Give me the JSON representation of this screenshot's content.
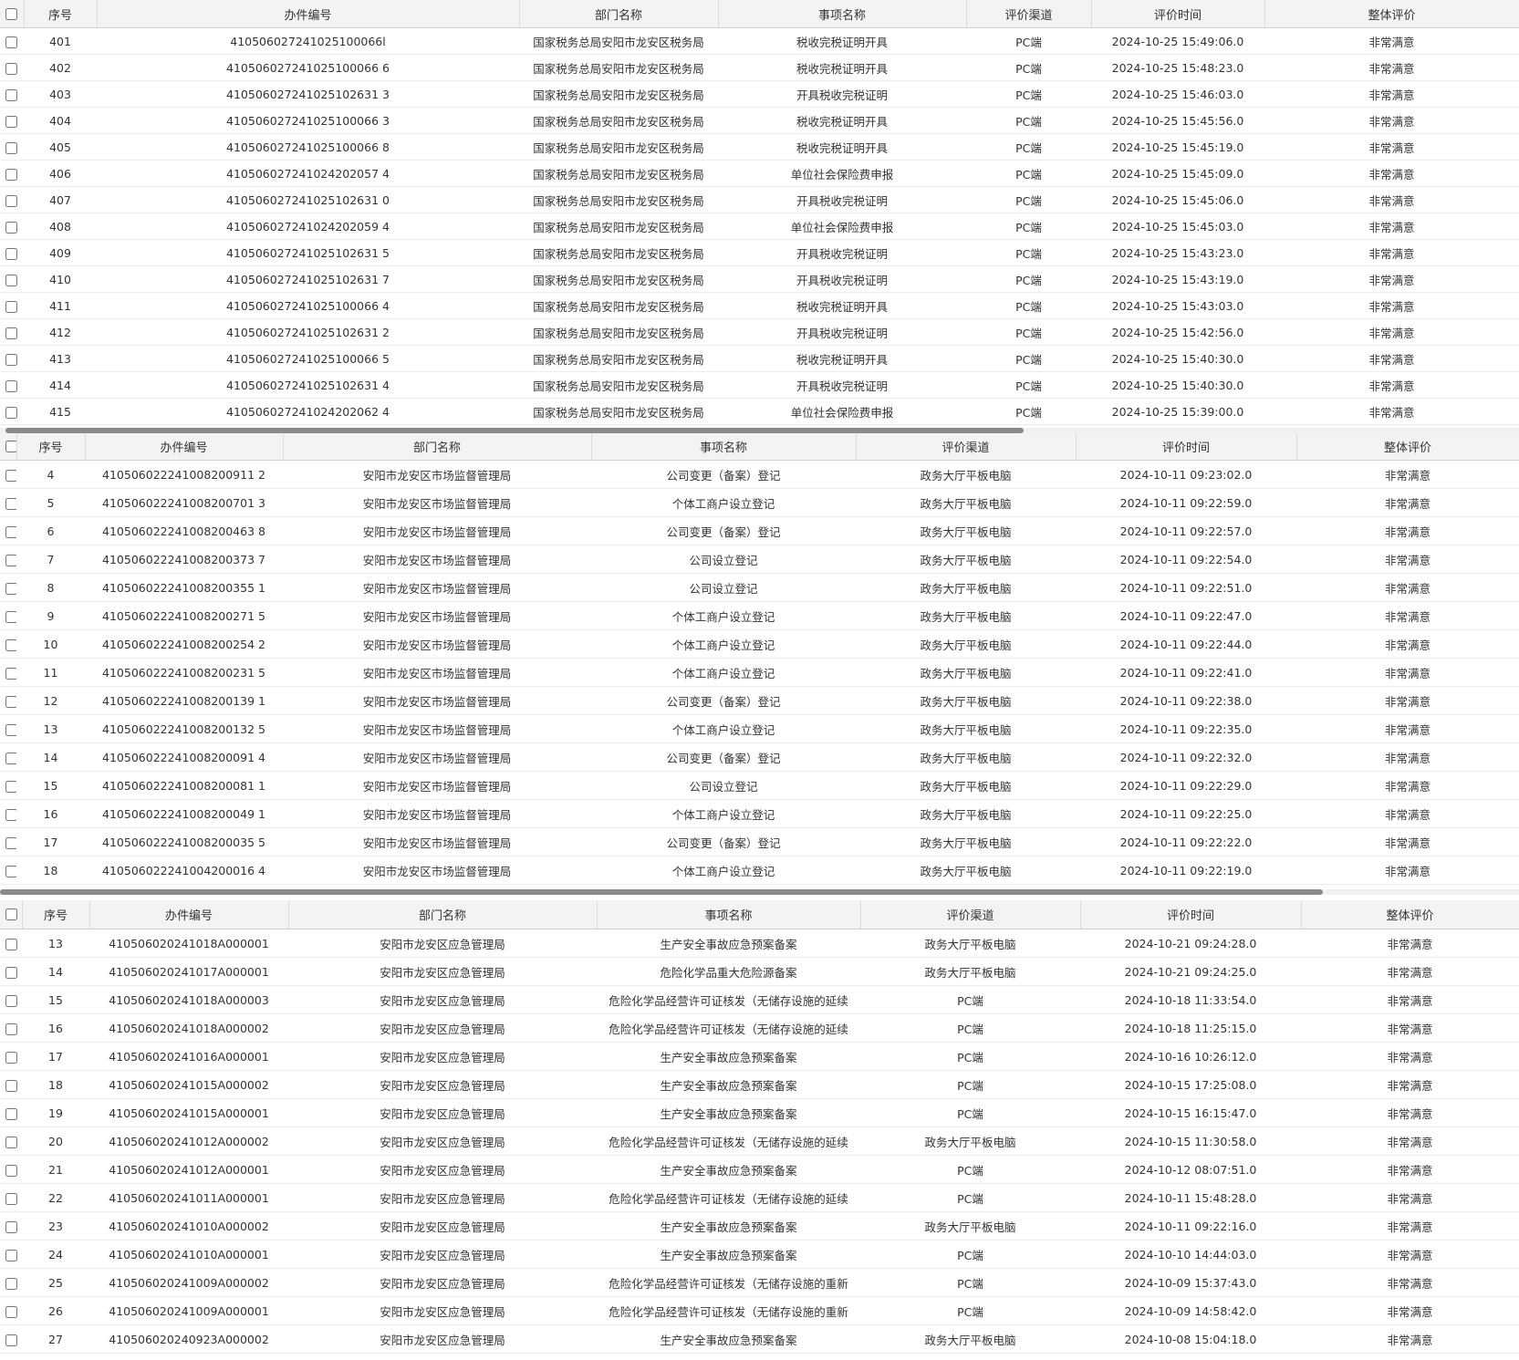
{
  "tables": [
    {
      "headers": [
        "序号",
        "办件编号",
        "部门名称",
        "事项名称",
        "评价渠道",
        "评价时间",
        "整体评价"
      ],
      "rows": [
        [
          "401",
          "410506027241025100066l",
          "国家税务总局安阳市龙安区税务局",
          "税收完税证明开具",
          "PC端",
          "2024-10-25 15:49:06.0",
          "非常满意"
        ],
        [
          "402",
          "410506027241025100066 6",
          "国家税务总局安阳市龙安区税务局",
          "税收完税证明开具",
          "PC端",
          "2024-10-25 15:48:23.0",
          "非常满意"
        ],
        [
          "403",
          "410506027241025102631 3",
          "国家税务总局安阳市龙安区税务局",
          "开具税收完税证明",
          "PC端",
          "2024-10-25 15:46:03.0",
          "非常满意"
        ],
        [
          "404",
          "410506027241025100066 3",
          "国家税务总局安阳市龙安区税务局",
          "税收完税证明开具",
          "PC端",
          "2024-10-25 15:45:56.0",
          "非常满意"
        ],
        [
          "405",
          "410506027241025100066 8",
          "国家税务总局安阳市龙安区税务局",
          "税收完税证明开具",
          "PC端",
          "2024-10-25 15:45:19.0",
          "非常满意"
        ],
        [
          "406",
          "410506027241024202057 4",
          "国家税务总局安阳市龙安区税务局",
          "单位社会保险费申报",
          "PC端",
          "2024-10-25 15:45:09.0",
          "非常满意"
        ],
        [
          "407",
          "410506027241025102631 0",
          "国家税务总局安阳市龙安区税务局",
          "开具税收完税证明",
          "PC端",
          "2024-10-25 15:45:06.0",
          "非常满意"
        ],
        [
          "408",
          "410506027241024202059 4",
          "国家税务总局安阳市龙安区税务局",
          "单位社会保险费申报",
          "PC端",
          "2024-10-25 15:45:03.0",
          "非常满意"
        ],
        [
          "409",
          "410506027241025102631 5",
          "国家税务总局安阳市龙安区税务局",
          "开具税收完税证明",
          "PC端",
          "2024-10-25 15:43:23.0",
          "非常满意"
        ],
        [
          "410",
          "410506027241025102631 7",
          "国家税务总局安阳市龙安区税务局",
          "开具税收完税证明",
          "PC端",
          "2024-10-25 15:43:19.0",
          "非常满意"
        ],
        [
          "411",
          "410506027241025100066 4",
          "国家税务总局安阳市龙安区税务局",
          "税收完税证明开具",
          "PC端",
          "2024-10-25 15:43:03.0",
          "非常满意"
        ],
        [
          "412",
          "410506027241025102631 2",
          "国家税务总局安阳市龙安区税务局",
          "开具税收完税证明",
          "PC端",
          "2024-10-25 15:42:56.0",
          "非常满意"
        ],
        [
          "413",
          "410506027241025100066 5",
          "国家税务总局安阳市龙安区税务局",
          "税收完税证明开具",
          "PC端",
          "2024-10-25 15:40:30.0",
          "非常满意"
        ],
        [
          "414",
          "410506027241025102631 4",
          "国家税务总局安阳市龙安区税务局",
          "开具税收完税证明",
          "PC端",
          "2024-10-25 15:40:30.0",
          "非常满意"
        ],
        [
          "415",
          "410506027241024202062 4",
          "国家税务总局安阳市龙安区税务局",
          "单位社会保险费申报",
          "PC端",
          "2024-10-25 15:39:00.0",
          "非常满意"
        ]
      ]
    },
    {
      "headers": [
        "序号",
        "办件编号",
        "部门名称",
        "事项名称",
        "评价渠道",
        "评价时间",
        "整体评价"
      ],
      "rows": [
        [
          "4",
          "410506022241008200911 2",
          "安阳市龙安区市场监督管理局",
          "公司变更（备案）登记",
          "政务大厅平板电脑",
          "2024-10-11 09:23:02.0",
          "非常满意"
        ],
        [
          "5",
          "410506022241008200701 3",
          "安阳市龙安区市场监督管理局",
          "个体工商户设立登记",
          "政务大厅平板电脑",
          "2024-10-11 09:22:59.0",
          "非常满意"
        ],
        [
          "6",
          "410506022241008200463 8",
          "安阳市龙安区市场监督管理局",
          "公司变更（备案）登记",
          "政务大厅平板电脑",
          "2024-10-11 09:22:57.0",
          "非常满意"
        ],
        [
          "7",
          "410506022241008200373 7",
          "安阳市龙安区市场监督管理局",
          "公司设立登记",
          "政务大厅平板电脑",
          "2024-10-11 09:22:54.0",
          "非常满意"
        ],
        [
          "8",
          "410506022241008200355 1",
          "安阳市龙安区市场监督管理局",
          "公司设立登记",
          "政务大厅平板电脑",
          "2024-10-11 09:22:51.0",
          "非常满意"
        ],
        [
          "9",
          "410506022241008200271 5",
          "安阳市龙安区市场监督管理局",
          "个体工商户设立登记",
          "政务大厅平板电脑",
          "2024-10-11 09:22:47.0",
          "非常满意"
        ],
        [
          "10",
          "410506022241008200254 2",
          "安阳市龙安区市场监督管理局",
          "个体工商户设立登记",
          "政务大厅平板电脑",
          "2024-10-11 09:22:44.0",
          "非常满意"
        ],
        [
          "11",
          "410506022241008200231 5",
          "安阳市龙安区市场监督管理局",
          "个体工商户设立登记",
          "政务大厅平板电脑",
          "2024-10-11 09:22:41.0",
          "非常满意"
        ],
        [
          "12",
          "410506022241008200139 1",
          "安阳市龙安区市场监督管理局",
          "公司变更（备案）登记",
          "政务大厅平板电脑",
          "2024-10-11 09:22:38.0",
          "非常满意"
        ],
        [
          "13",
          "410506022241008200132 5",
          "安阳市龙安区市场监督管理局",
          "个体工商户设立登记",
          "政务大厅平板电脑",
          "2024-10-11 09:22:35.0",
          "非常满意"
        ],
        [
          "14",
          "410506022241008200091 4",
          "安阳市龙安区市场监督管理局",
          "公司变更（备案）登记",
          "政务大厅平板电脑",
          "2024-10-11 09:22:32.0",
          "非常满意"
        ],
        [
          "15",
          "410506022241008200081 1",
          "安阳市龙安区市场监督管理局",
          "公司设立登记",
          "政务大厅平板电脑",
          "2024-10-11 09:22:29.0",
          "非常满意"
        ],
        [
          "16",
          "410506022241008200049 1",
          "安阳市龙安区市场监督管理局",
          "个体工商户设立登记",
          "政务大厅平板电脑",
          "2024-10-11 09:22:25.0",
          "非常满意"
        ],
        [
          "17",
          "410506022241008200035 5",
          "安阳市龙安区市场监督管理局",
          "公司变更（备案）登记",
          "政务大厅平板电脑",
          "2024-10-11 09:22:22.0",
          "非常满意"
        ],
        [
          "18",
          "410506022241004200016 4",
          "安阳市龙安区市场监督管理局",
          "个体工商户设立登记",
          "政务大厅平板电脑",
          "2024-10-11 09:22:19.0",
          "非常满意"
        ]
      ]
    },
    {
      "headers": [
        "序号",
        "办件编号",
        "部门名称",
        "事项名称",
        "评价渠道",
        "评价时间",
        "整体评价"
      ],
      "rows": [
        [
          "13",
          "410506020241018A000001",
          "安阳市龙安区应急管理局",
          "生产安全事故应急预案备案",
          "政务大厅平板电脑",
          "2024-10-21 09:24:28.0",
          "非常满意"
        ],
        [
          "14",
          "410506020241017A000001",
          "安阳市龙安区应急管理局",
          "危险化学品重大危险源备案",
          "政务大厅平板电脑",
          "2024-10-21 09:24:25.0",
          "非常满意"
        ],
        [
          "15",
          "410506020241018A000003",
          "安阳市龙安区应急管理局",
          "危险化学品经营许可证核发（无储存设施的延续",
          "PC端",
          "2024-10-18 11:33:54.0",
          "非常满意"
        ],
        [
          "16",
          "410506020241018A000002",
          "安阳市龙安区应急管理局",
          "危险化学品经营许可证核发（无储存设施的延续",
          "PC端",
          "2024-10-18 11:25:15.0",
          "非常满意"
        ],
        [
          "17",
          "410506020241016A000001",
          "安阳市龙安区应急管理局",
          "生产安全事故应急预案备案",
          "PC端",
          "2024-10-16 10:26:12.0",
          "非常满意"
        ],
        [
          "18",
          "410506020241015A000002",
          "安阳市龙安区应急管理局",
          "生产安全事故应急预案备案",
          "PC端",
          "2024-10-15 17:25:08.0",
          "非常满意"
        ],
        [
          "19",
          "410506020241015A000001",
          "安阳市龙安区应急管理局",
          "生产安全事故应急预案备案",
          "PC端",
          "2024-10-15 16:15:47.0",
          "非常满意"
        ],
        [
          "20",
          "410506020241012A000002",
          "安阳市龙安区应急管理局",
          "危险化学品经营许可证核发（无储存设施的延续",
          "政务大厅平板电脑",
          "2024-10-15 11:30:58.0",
          "非常满意"
        ],
        [
          "21",
          "410506020241012A000001",
          "安阳市龙安区应急管理局",
          "生产安全事故应急预案备案",
          "PC端",
          "2024-10-12 08:07:51.0",
          "非常满意"
        ],
        [
          "22",
          "410506020241011A000001",
          "安阳市龙安区应急管理局",
          "危险化学品经营许可证核发（无储存设施的延续",
          "PC端",
          "2024-10-11 15:48:28.0",
          "非常满意"
        ],
        [
          "23",
          "410506020241010A000002",
          "安阳市龙安区应急管理局",
          "生产安全事故应急预案备案",
          "政务大厅平板电脑",
          "2024-10-11 09:22:16.0",
          "非常满意"
        ],
        [
          "24",
          "410506020241010A000001",
          "安阳市龙安区应急管理局",
          "生产安全事故应急预案备案",
          "PC端",
          "2024-10-10 14:44:03.0",
          "非常满意"
        ],
        [
          "25",
          "410506020241009A000002",
          "安阳市龙安区应急管理局",
          "危险化学品经营许可证核发（无储存设施的重新",
          "PC端",
          "2024-10-09 15:37:43.0",
          "非常满意"
        ],
        [
          "26",
          "410506020241009A000001",
          "安阳市龙安区应急管理局",
          "危险化学品经营许可证核发（无储存设施的重新",
          "PC端",
          "2024-10-09 14:58:42.0",
          "非常满意"
        ],
        [
          "27",
          "410506020240923A000002",
          "安阳市龙安区应急管理局",
          "生产安全事故应急预案备案",
          "政务大厅平板电脑",
          "2024-10-08 15:04:18.0",
          "非常满意"
        ]
      ]
    }
  ]
}
